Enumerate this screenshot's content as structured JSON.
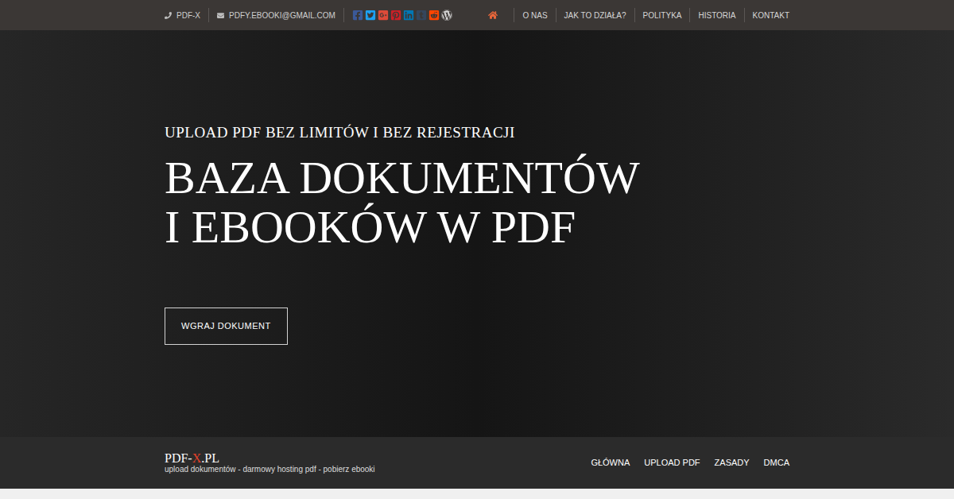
{
  "top_bar": {
    "contacts": [
      {
        "kind": "phone",
        "text": "PDF-X"
      },
      {
        "kind": "mail",
        "text": "PDFY.EBOOKI@GMAIL.COM"
      }
    ],
    "social": [
      {
        "kind": "facebook",
        "color": "#3b5998"
      },
      {
        "kind": "twitter",
        "color": "#1da1f2"
      },
      {
        "kind": "googleplus",
        "color": "#dd4b39"
      },
      {
        "kind": "pinterest",
        "color": "#cb2027"
      },
      {
        "kind": "linkedin",
        "color": "#0077b5"
      },
      {
        "kind": "tumblr",
        "color": "#35465c"
      },
      {
        "kind": "reddit",
        "color": "#ff4500"
      },
      {
        "kind": "wordpress",
        "color": "#d8d8d8"
      }
    ],
    "home": {
      "selected": true
    },
    "nav": [
      {
        "label": "O NAS",
        "selected": false
      },
      {
        "label": "JAK TO DZIAŁA?",
        "selected": false
      },
      {
        "label": "POLITYKA",
        "selected": false
      },
      {
        "label": "HISTORIA",
        "selected": false
      },
      {
        "label": "KONTAKT",
        "selected": false
      }
    ]
  },
  "hero": {
    "subtitle": "UPLOAD PDF BEZ LIMITÓW I BEZ REJESTRACJI",
    "title_lines": [
      "BAZA DOKUMENTÓW",
      "I EBOOKÓW W PDF"
    ],
    "button": "WGRAJ DOKUMENT"
  },
  "footer": {
    "logo": {
      "prefix": "PDF-",
      "accent": "X",
      "suffix": ".PL"
    },
    "tagline": "upload dokumentów - darmowy hosting pdf - pobierz ebooki",
    "nav": [
      {
        "label": "GŁÓWNA",
        "selected": false
      },
      {
        "label": "UPLOAD PDF",
        "selected": false
      },
      {
        "label": "ZASADY",
        "selected": false
      },
      {
        "label": "DMCA",
        "selected": false
      }
    ]
  }
}
